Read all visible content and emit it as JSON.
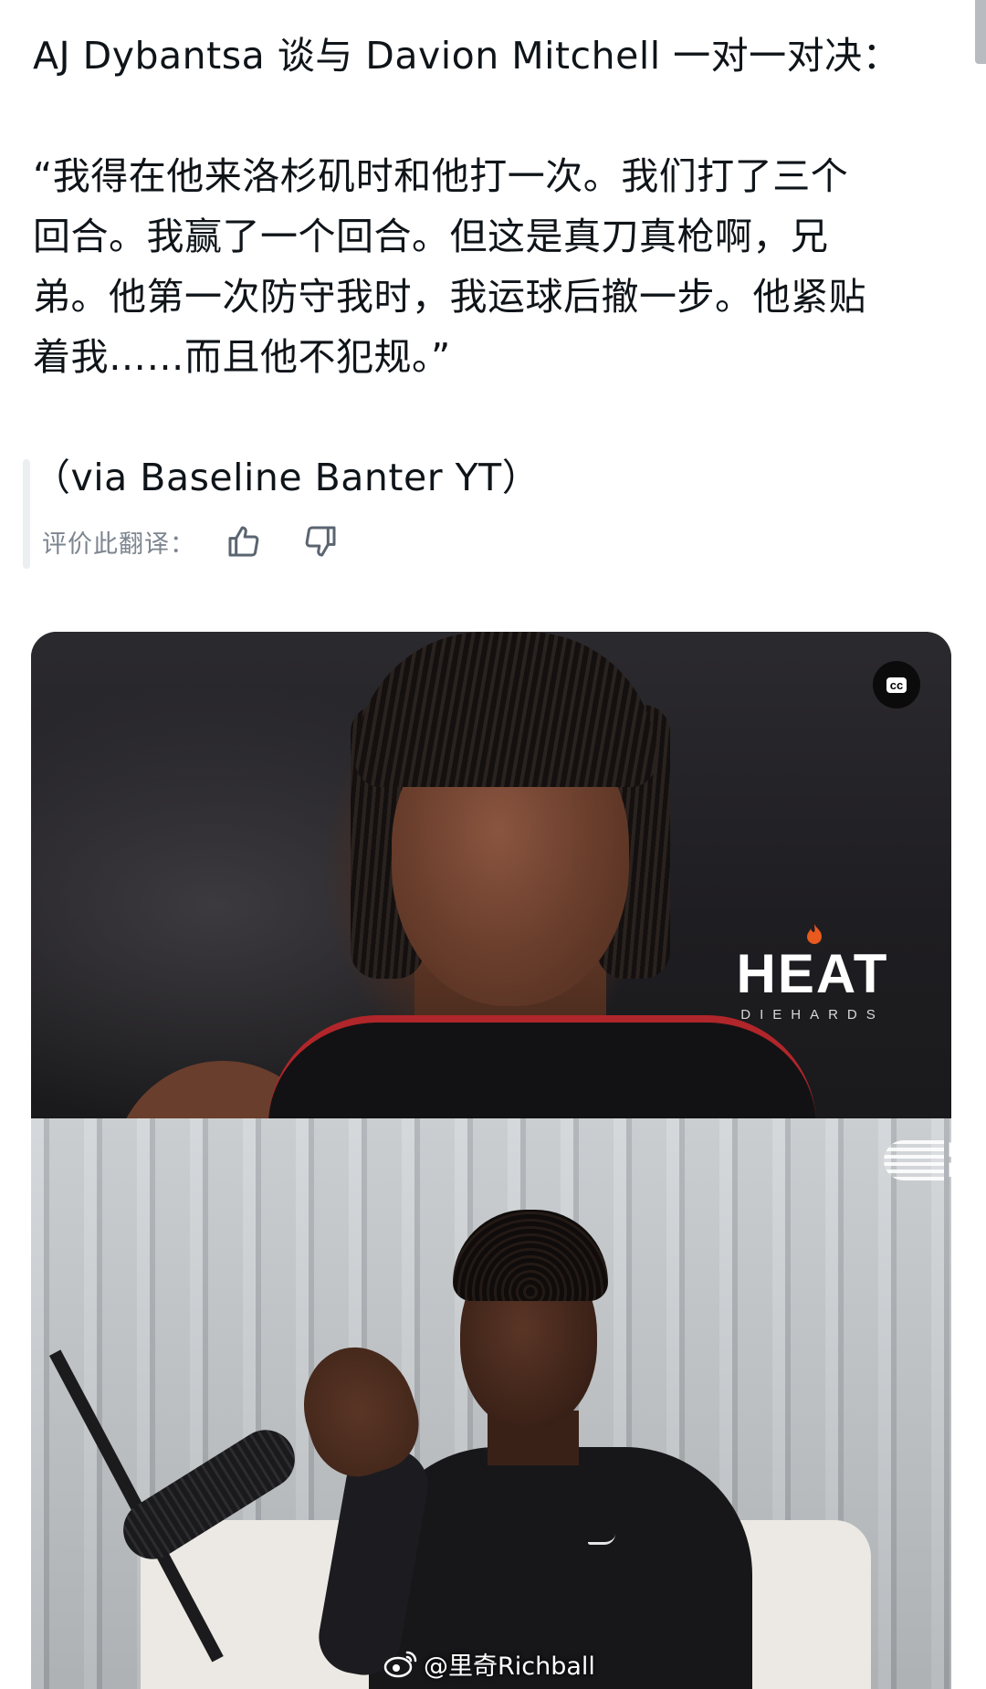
{
  "post": {
    "title_line": "AJ Dybantsa 谈与 Davion Mitchell 一对一对决：",
    "quote_lines": [
      "“我得在他来洛杉矶时和他打一次。我们打了三个",
      "回合。我赢了一个回合。但这是真刀真枪啊，兄",
      "弟。他第一次防守我时，我运球后撤一步。他紧贴",
      "着我……而且他不犯规。”"
    ],
    "source": "（via Baseline Banter YT）"
  },
  "translation_rating": {
    "label": "评价此翻译：",
    "thumbs_up_icon": "thumbs-up-icon",
    "thumbs_down_icon": "thumbs-down-icon"
  },
  "media": {
    "cc_label": "cc",
    "top_logo": {
      "word": "HEAT",
      "sub": "DIEHARDS"
    },
    "bottom_logo": {
      "letters": [
        "B",
        "B"
      ]
    }
  },
  "watermark": {
    "text": "@里奇Richball",
    "icon": "weibo-icon"
  },
  "colors": {
    "text": "#0f1419",
    "muted": "#7d8590",
    "jersey_trim": "#b0262a"
  }
}
